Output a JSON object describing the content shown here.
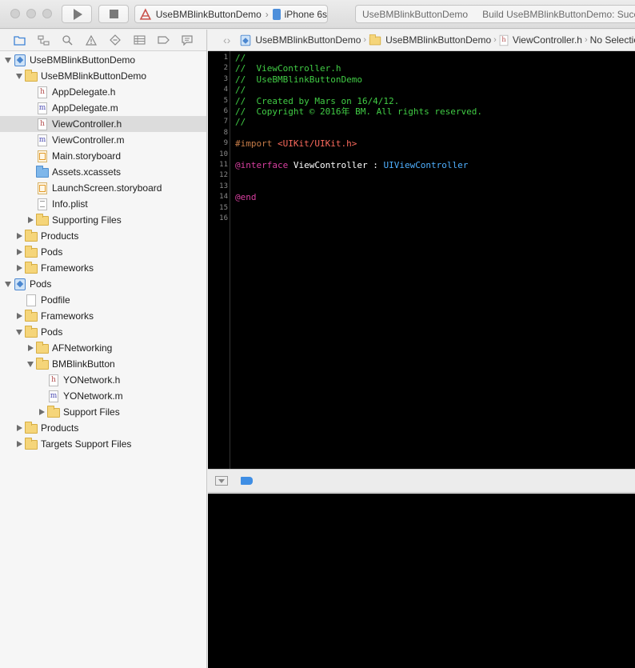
{
  "toolbar": {
    "scheme_name": "UseBMBlinkButtonDemo",
    "separator": "›",
    "device": "iPhone 6s",
    "activity_project": "UseBMBlinkButtonDemo",
    "activity_status": "Build UseBMBlinkButtonDemo: Succeeded"
  },
  "navigator": {
    "tabs": [
      "folder-icon",
      "hierarchy-icon",
      "search-icon",
      "warning-icon",
      "test-diamond-icon",
      "debug-grid-icon",
      "breakpoint-icon",
      "report-icon"
    ],
    "tree": [
      {
        "label": "UseBMBlinkButtonDemo",
        "icon": "project-icon",
        "depth": 0,
        "disclosure": "open"
      },
      {
        "label": "UseBMBlinkButtonDemo",
        "icon": "folder-icon",
        "depth": 1,
        "disclosure": "open"
      },
      {
        "label": "AppDelegate.h",
        "icon": "header-file-icon",
        "depth": 2,
        "disclosure": "none"
      },
      {
        "label": "AppDelegate.m",
        "icon": "source-file-icon",
        "depth": 2,
        "disclosure": "none"
      },
      {
        "label": "ViewController.h",
        "icon": "header-file-icon",
        "depth": 2,
        "disclosure": "none",
        "selected": true
      },
      {
        "label": "ViewController.m",
        "icon": "source-file-icon",
        "depth": 2,
        "disclosure": "none"
      },
      {
        "label": "Main.storyboard",
        "icon": "storyboard-icon",
        "depth": 2,
        "disclosure": "none"
      },
      {
        "label": "Assets.xcassets",
        "icon": "asset-folder-icon",
        "depth": 2,
        "disclosure": "none"
      },
      {
        "label": "LaunchScreen.storyboard",
        "icon": "storyboard-icon",
        "depth": 2,
        "disclosure": "none"
      },
      {
        "label": "Info.plist",
        "icon": "plist-icon",
        "depth": 2,
        "disclosure": "none"
      },
      {
        "label": "Supporting Files",
        "icon": "folder-icon",
        "depth": 2,
        "disclosure": "closed"
      },
      {
        "label": "Products",
        "icon": "folder-icon",
        "depth": 1,
        "disclosure": "closed"
      },
      {
        "label": "Pods",
        "icon": "folder-icon",
        "depth": 1,
        "disclosure": "closed"
      },
      {
        "label": "Frameworks",
        "icon": "folder-icon",
        "depth": 1,
        "disclosure": "closed"
      },
      {
        "label": "Pods",
        "icon": "project-icon",
        "depth": 0,
        "disclosure": "open"
      },
      {
        "label": "Podfile",
        "icon": "plain-file-icon",
        "depth": 1,
        "disclosure": "none"
      },
      {
        "label": "Frameworks",
        "icon": "folder-icon",
        "depth": 1,
        "disclosure": "closed"
      },
      {
        "label": "Pods",
        "icon": "folder-icon",
        "depth": 1,
        "disclosure": "open"
      },
      {
        "label": "AFNetworking",
        "icon": "folder-icon",
        "depth": 2,
        "disclosure": "closed"
      },
      {
        "label": "BMBlinkButton",
        "icon": "folder-icon",
        "depth": 2,
        "disclosure": "open"
      },
      {
        "label": "YONetwork.h",
        "icon": "header-file-icon",
        "depth": 3,
        "disclosure": "none"
      },
      {
        "label": "YONetwork.m",
        "icon": "source-file-icon",
        "depth": 3,
        "disclosure": "none"
      },
      {
        "label": "Support Files",
        "icon": "folder-icon",
        "depth": 3,
        "disclosure": "closed"
      },
      {
        "label": "Products",
        "icon": "folder-icon",
        "depth": 1,
        "disclosure": "closed"
      },
      {
        "label": "Targets Support Files",
        "icon": "folder-icon",
        "depth": 1,
        "disclosure": "closed"
      }
    ]
  },
  "jumpbar": {
    "back": "‹",
    "forward": "›",
    "crumbs": [
      {
        "label": "UseBMBlinkButtonDemo",
        "icon": "project-icon"
      },
      {
        "label": "UseBMBlinkButtonDemo",
        "icon": "folder-icon"
      },
      {
        "label": "ViewController.h",
        "icon": "header-file-icon"
      },
      {
        "label": "No Selection",
        "icon": "none"
      }
    ]
  },
  "editor": {
    "lines": [
      {
        "n": "1",
        "tokens": [
          {
            "t": "//",
            "c": "comment"
          }
        ]
      },
      {
        "n": "2",
        "tokens": [
          {
            "t": "//  ViewController.h",
            "c": "comment"
          }
        ]
      },
      {
        "n": "3",
        "tokens": [
          {
            "t": "//  UseBMBlinkButtonDemo",
            "c": "comment"
          }
        ]
      },
      {
        "n": "4",
        "tokens": [
          {
            "t": "//",
            "c": "comment"
          }
        ]
      },
      {
        "n": "5",
        "tokens": [
          {
            "t": "//  Created by Mars on 16/4/12.",
            "c": "comment"
          }
        ]
      },
      {
        "n": "6",
        "tokens": [
          {
            "t": "//  Copyright © 2016年 BM. All rights reserved.",
            "c": "comment"
          }
        ]
      },
      {
        "n": "7",
        "tokens": [
          {
            "t": "//",
            "c": "comment"
          }
        ]
      },
      {
        "n": "8",
        "tokens": []
      },
      {
        "n": "9",
        "tokens": [
          {
            "t": "#import ",
            "c": "pre"
          },
          {
            "t": "<UIKit/UIKit.h>",
            "c": "str"
          }
        ]
      },
      {
        "n": "10",
        "tokens": []
      },
      {
        "n": "11",
        "tokens": [
          {
            "t": "@interface",
            "c": "kw"
          },
          {
            "t": " ViewController : ",
            "c": "plain"
          },
          {
            "t": "UIViewController",
            "c": "type"
          }
        ]
      },
      {
        "n": "12",
        "tokens": []
      },
      {
        "n": "13",
        "tokens": []
      },
      {
        "n": "14",
        "tokens": [
          {
            "t": "@end",
            "c": "kw"
          }
        ]
      },
      {
        "n": "15",
        "tokens": []
      },
      {
        "n": "16",
        "tokens": []
      }
    ]
  },
  "colors": {
    "comment": "#41cc45",
    "keyword": "#d83fa0",
    "string": "#fc6a5d",
    "type": "#4fb0ff",
    "editor_bg": "#000000"
  }
}
